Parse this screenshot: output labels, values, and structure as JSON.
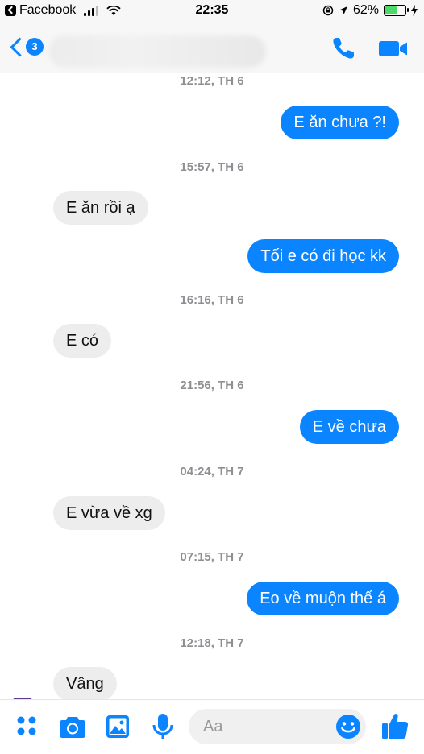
{
  "status_bar": {
    "back_app": "Facebook",
    "time": "22:35",
    "battery": "62%",
    "battery_level": 0.62
  },
  "header": {
    "unread_badge": "3"
  },
  "messages": [
    {
      "kind": "timestamp",
      "text": "12:12, TH 6"
    },
    {
      "kind": "outgoing",
      "text": "E ăn chưa ?!"
    },
    {
      "kind": "timestamp",
      "text": "15:57, TH 6"
    },
    {
      "kind": "incoming",
      "text": "E ăn rồi ạ"
    },
    {
      "kind": "outgoing",
      "text": "Tối e có đi học kk"
    },
    {
      "kind": "timestamp",
      "text": "16:16, TH 6"
    },
    {
      "kind": "incoming",
      "text": "E có"
    },
    {
      "kind": "timestamp",
      "text": "21:56, TH 6"
    },
    {
      "kind": "outgoing",
      "text": "E về chưa"
    },
    {
      "kind": "timestamp",
      "text": "04:24, TH 7"
    },
    {
      "kind": "incoming",
      "text": "E vừa về xg"
    },
    {
      "kind": "timestamp",
      "text": "07:15, TH 7"
    },
    {
      "kind": "outgoing",
      "text": "Eo về muộn thế á"
    },
    {
      "kind": "timestamp",
      "text": "12:18, TH 7"
    },
    {
      "kind": "incoming",
      "text": "Vâng"
    }
  ],
  "composer": {
    "placeholder": "Aa"
  },
  "colors": {
    "accent": "#0a84ff",
    "incoming_bubble": "#ededed",
    "timestamp": "#8e8e93"
  }
}
